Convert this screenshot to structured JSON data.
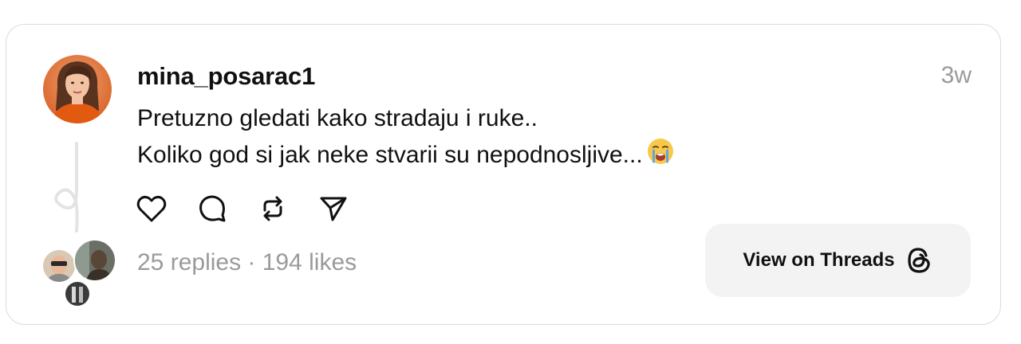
{
  "post": {
    "username": "mina_posarac1",
    "timestamp": "3w",
    "text_line1": "Pretuzno gledati kako stradaju i ruke..",
    "text_line2": "Koliko god si jak neke stvarii su nepodnosljive...",
    "emoji": "loudly-crying-face-emoji"
  },
  "actions": {
    "like": "heart-icon",
    "comment": "comment-icon",
    "repost": "repost-icon",
    "share": "send-icon"
  },
  "stats": {
    "text": "25 replies · 194 likes"
  },
  "cta": {
    "label": "View on Threads",
    "icon": "threads-logo-icon"
  }
}
